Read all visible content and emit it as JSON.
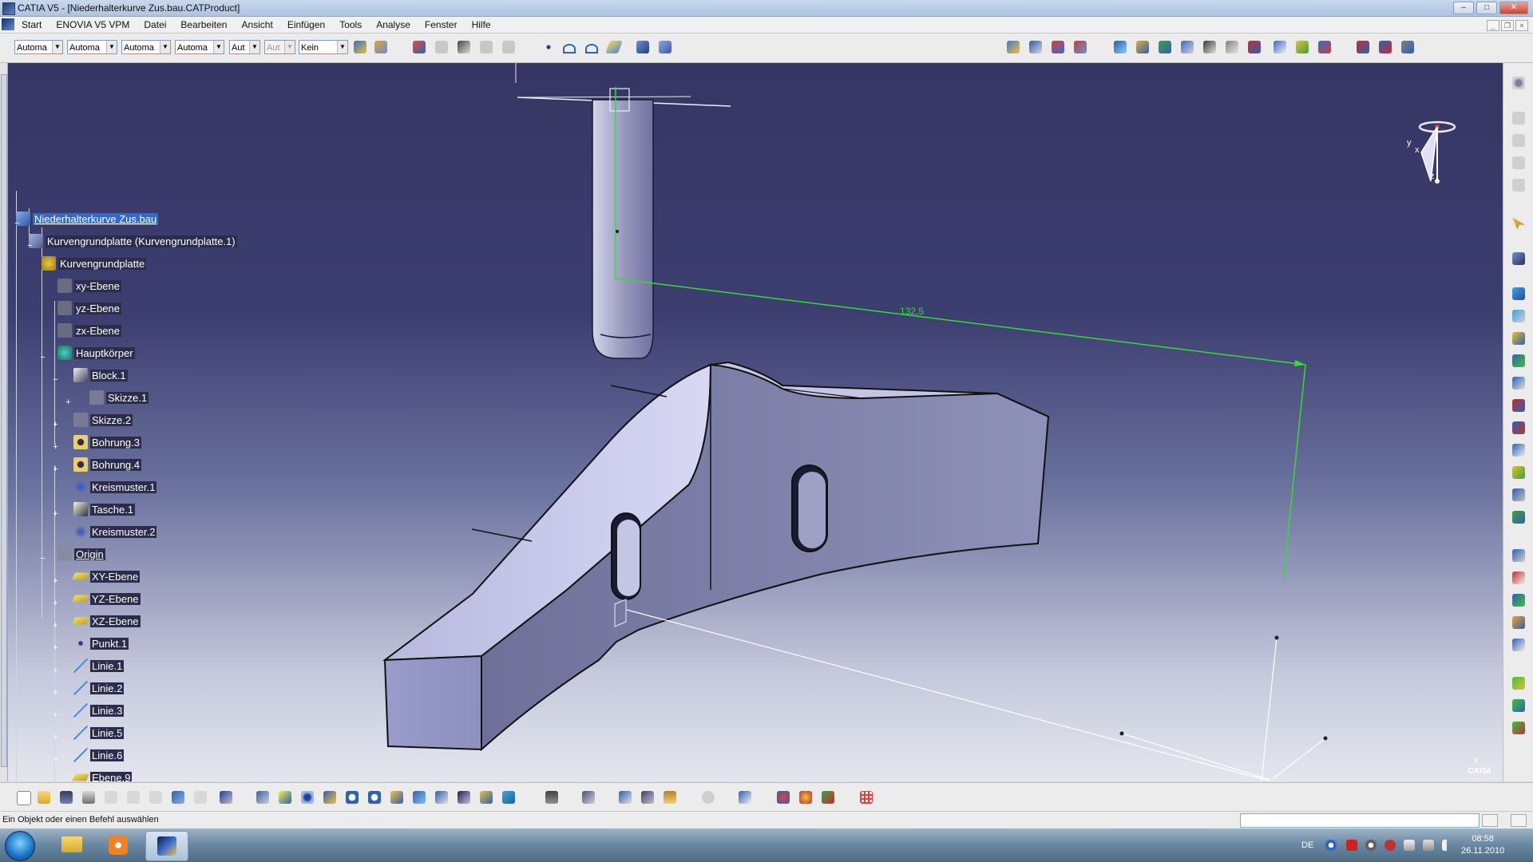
{
  "window": {
    "title": "CATIA V5 - [Niederhalterkurve Zus.bau.CATProduct]"
  },
  "menu": [
    "Start",
    "ENOVIA V5 VPM",
    "Datei",
    "Bearbeiten",
    "Ansicht",
    "Einfügen",
    "Tools",
    "Analyse",
    "Fenster",
    "Hilfe"
  ],
  "combos": [
    "Automa",
    "Automa",
    "Automa",
    "Automa",
    "Aut",
    "Aut",
    "Kein"
  ],
  "tree": {
    "root": "Niederhalterkurve Zus.bau",
    "items": [
      "Kurvengrundplatte (Kurvengrundplatte.1)",
      "Kurvengrundplatte",
      "xy-Ebene",
      "yz-Ebene",
      "zx-Ebene",
      "Hauptkörper",
      "Block.1",
      "Skizze.1",
      "Skizze.2",
      "Bohrung.3",
      "Bohrung.4",
      "Kreismuster.1",
      "Tasche.1",
      "Kreismuster.2",
      "Origin",
      "XY-Ebene",
      "YZ-Ebene",
      "XZ-Ebene",
      "Punkt.1",
      "Linie.1",
      "Linie.2",
      "Linie.3",
      "Linie.5",
      "Linie.6",
      "Ebene.9"
    ]
  },
  "viewport": {
    "dimension": "132,5",
    "compass_axes": [
      "y",
      "x",
      "z"
    ],
    "corner_axis": "x"
  },
  "brand": "CATIA",
  "status": {
    "message": "Ein Objekt oder einen Befehl auswählen"
  },
  "taskbar": {
    "language": "DE",
    "time": "08:58",
    "date": "26.11.2010"
  },
  "colors": {
    "viewport_top": "#363664",
    "viewport_bottom": "#e4e6ee",
    "dimension": "#33dd33",
    "selection": "#2b6bd6"
  }
}
